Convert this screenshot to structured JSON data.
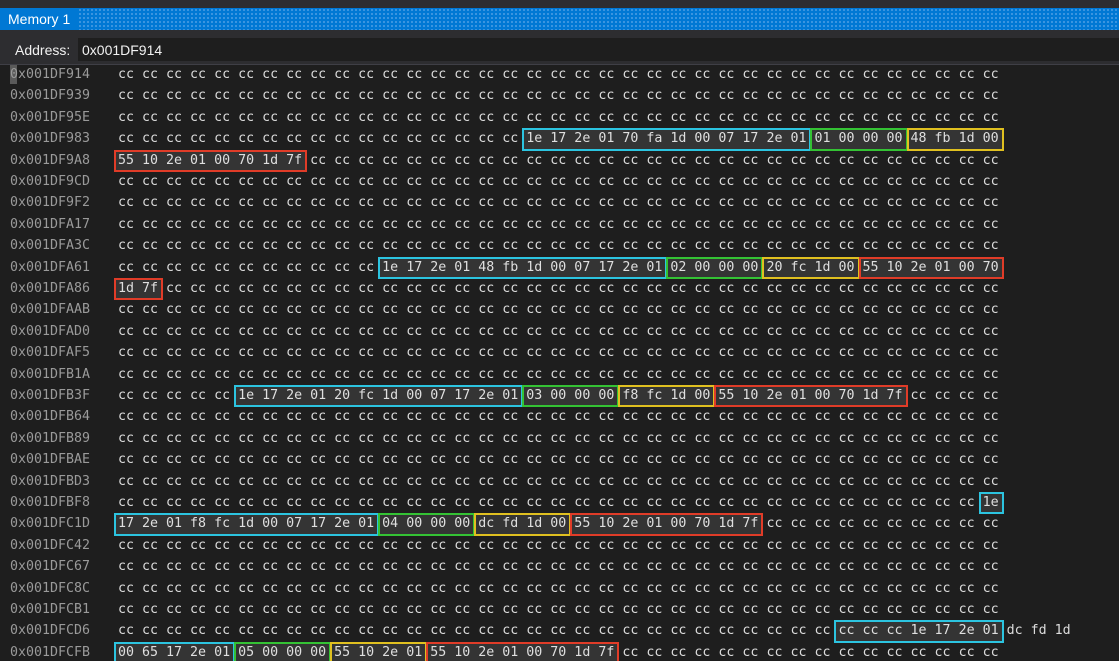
{
  "window": {
    "tab_title": "Memory 1"
  },
  "address_bar": {
    "label": "Address:",
    "value": "0x001DF914"
  },
  "colors": {
    "cyan": "#2cc4e0",
    "green": "#34c234",
    "yellow": "#e0c020",
    "red": "#e03c28"
  },
  "rows": [
    {
      "address": "0x001DF914",
      "bytes": "cc cc cc cc cc cc cc cc cc cc cc cc cc cc cc cc cc cc cc cc cc cc cc cc cc cc cc cc cc cc cc cc cc cc cc cc cc"
    },
    {
      "address": "0x001DF939",
      "bytes": "cc cc cc cc cc cc cc cc cc cc cc cc cc cc cc cc cc cc cc cc cc cc cc cc cc cc cc cc cc cc cc cc cc cc cc cc cc"
    },
    {
      "address": "0x001DF95E",
      "bytes": "cc cc cc cc cc cc cc cc cc cc cc cc cc cc cc cc cc cc cc cc cc cc cc cc cc cc cc cc cc cc cc cc cc cc cc cc cc"
    },
    {
      "address": "0x001DF983",
      "bytes": "cc cc cc cc cc cc cc cc cc cc cc cc cc cc cc cc cc 1e 17 2e 01 70 fa 1d 00 07 17 2e 01 01 00 00 00 48 fb 1d 00"
    },
    {
      "address": "0x001DF9A8",
      "bytes": "55 10 2e 01 00 70 1d 7f cc cc cc cc cc cc cc cc cc cc cc cc cc cc cc cc cc cc cc cc cc cc cc cc cc cc cc cc cc"
    },
    {
      "address": "0x001DF9CD",
      "bytes": "cc cc cc cc cc cc cc cc cc cc cc cc cc cc cc cc cc cc cc cc cc cc cc cc cc cc cc cc cc cc cc cc cc cc cc cc cc"
    },
    {
      "address": "0x001DF9F2",
      "bytes": "cc cc cc cc cc cc cc cc cc cc cc cc cc cc cc cc cc cc cc cc cc cc cc cc cc cc cc cc cc cc cc cc cc cc cc cc cc"
    },
    {
      "address": "0x001DFA17",
      "bytes": "cc cc cc cc cc cc cc cc cc cc cc cc cc cc cc cc cc cc cc cc cc cc cc cc cc cc cc cc cc cc cc cc cc cc cc cc cc"
    },
    {
      "address": "0x001DFA3C",
      "bytes": "cc cc cc cc cc cc cc cc cc cc cc cc cc cc cc cc cc cc cc cc cc cc cc cc cc cc cc cc cc cc cc cc cc cc cc cc cc"
    },
    {
      "address": "0x001DFA61",
      "bytes": "cc cc cc cc cc cc cc cc cc cc cc 1e 17 2e 01 48 fb 1d 00 07 17 2e 01 02 00 00 00 20 fc 1d 00 55 10 2e 01 00 70"
    },
    {
      "address": "0x001DFA86",
      "bytes": "1d 7f cc cc cc cc cc cc cc cc cc cc cc cc cc cc cc cc cc cc cc cc cc cc cc cc cc cc cc cc cc cc cc cc cc cc cc"
    },
    {
      "address": "0x001DFAAB",
      "bytes": "cc cc cc cc cc cc cc cc cc cc cc cc cc cc cc cc cc cc cc cc cc cc cc cc cc cc cc cc cc cc cc cc cc cc cc cc cc"
    },
    {
      "address": "0x001DFAD0",
      "bytes": "cc cc cc cc cc cc cc cc cc cc cc cc cc cc cc cc cc cc cc cc cc cc cc cc cc cc cc cc cc cc cc cc cc cc cc cc cc"
    },
    {
      "address": "0x001DFAF5",
      "bytes": "cc cc cc cc cc cc cc cc cc cc cc cc cc cc cc cc cc cc cc cc cc cc cc cc cc cc cc cc cc cc cc cc cc cc cc cc cc"
    },
    {
      "address": "0x001DFB1A",
      "bytes": "cc cc cc cc cc cc cc cc cc cc cc cc cc cc cc cc cc cc cc cc cc cc cc cc cc cc cc cc cc cc cc cc cc cc cc cc cc"
    },
    {
      "address": "0x001DFB3F",
      "bytes": "cc cc cc cc cc 1e 17 2e 01 20 fc 1d 00 07 17 2e 01 03 00 00 00 f8 fc 1d 00 55 10 2e 01 00 70 1d 7f cc cc cc cc"
    },
    {
      "address": "0x001DFB64",
      "bytes": "cc cc cc cc cc cc cc cc cc cc cc cc cc cc cc cc cc cc cc cc cc cc cc cc cc cc cc cc cc cc cc cc cc cc cc cc cc"
    },
    {
      "address": "0x001DFB89",
      "bytes": "cc cc cc cc cc cc cc cc cc cc cc cc cc cc cc cc cc cc cc cc cc cc cc cc cc cc cc cc cc cc cc cc cc cc cc cc cc"
    },
    {
      "address": "0x001DFBAE",
      "bytes": "cc cc cc cc cc cc cc cc cc cc cc cc cc cc cc cc cc cc cc cc cc cc cc cc cc cc cc cc cc cc cc cc cc cc cc cc cc"
    },
    {
      "address": "0x001DFBD3",
      "bytes": "cc cc cc cc cc cc cc cc cc cc cc cc cc cc cc cc cc cc cc cc cc cc cc cc cc cc cc cc cc cc cc cc cc cc cc cc cc"
    },
    {
      "address": "0x001DFBF8",
      "bytes": "cc cc cc cc cc cc cc cc cc cc cc cc cc cc cc cc cc cc cc cc cc cc cc cc cc cc cc cc cc cc cc cc cc cc cc cc 1e"
    },
    {
      "address": "0x001DFC1D",
      "bytes": "17 2e 01 f8 fc 1d 00 07 17 2e 01 04 00 00 00 dc fd 1d 00 55 10 2e 01 00 70 1d 7f cc cc cc cc cc cc cc cc cc cc"
    },
    {
      "address": "0x001DFC42",
      "bytes": "cc cc cc cc cc cc cc cc cc cc cc cc cc cc cc cc cc cc cc cc cc cc cc cc cc cc cc cc cc cc cc cc cc cc cc cc cc"
    },
    {
      "address": "0x001DFC67",
      "bytes": "cc cc cc cc cc cc cc cc cc cc cc cc cc cc cc cc cc cc cc cc cc cc cc cc cc cc cc cc cc cc cc cc cc cc cc cc cc"
    },
    {
      "address": "0x001DFC8C",
      "bytes": "cc cc cc cc cc cc cc cc cc cc cc cc cc cc cc cc cc cc cc cc cc cc cc cc cc cc cc cc cc cc cc cc cc cc cc cc cc"
    },
    {
      "address": "0x001DFCB1",
      "bytes": "cc cc cc cc cc cc cc cc cc cc cc cc cc cc cc cc cc cc cc cc cc cc cc cc cc cc cc cc cc cc cc cc cc cc cc cc cc"
    },
    {
      "address": "0x001DFCD6",
      "bytes": "cc cc cc cc cc cc cc cc cc cc cc cc cc cc cc cc cc cc cc cc cc cc cc cc cc cc cc cc cc cc cc cc cc 1e 17 2e 01 dc fd 1d"
    },
    {
      "address": "0x001DFCFB",
      "bytes": "00 65 17 2e 01 05 00 00 00 55 10 2e 01 55 10 2e 01 00 70 1d 7f cc cc cc cc cc cc cc cc cc cc cc cc cc cc cc cc"
    }
  ],
  "highlights": [
    {
      "row": 3,
      "start": 17,
      "length": 12,
      "color": "cyan"
    },
    {
      "row": 3,
      "start": 29,
      "length": 4,
      "color": "green"
    },
    {
      "row": 3,
      "start": 33,
      "length": 4,
      "color": "yellow"
    },
    {
      "row": 4,
      "start": 0,
      "length": 8,
      "color": "red"
    },
    {
      "row": 9,
      "start": 11,
      "length": 12,
      "color": "cyan"
    },
    {
      "row": 9,
      "start": 23,
      "length": 4,
      "color": "green"
    },
    {
      "row": 9,
      "start": 27,
      "length": 4,
      "color": "yellow"
    },
    {
      "row": 9,
      "start": 31,
      "length": 6,
      "color": "red"
    },
    {
      "row": 10,
      "start": 0,
      "length": 2,
      "color": "red"
    },
    {
      "row": 15,
      "start": 5,
      "length": 12,
      "color": "cyan"
    },
    {
      "row": 15,
      "start": 17,
      "length": 4,
      "color": "green"
    },
    {
      "row": 15,
      "start": 21,
      "length": 4,
      "color": "yellow"
    },
    {
      "row": 15,
      "start": 25,
      "length": 8,
      "color": "red"
    },
    {
      "row": 20,
      "start": 36,
      "length": 1,
      "color": "cyan"
    },
    {
      "row": 21,
      "start": 0,
      "length": 11,
      "color": "cyan"
    },
    {
      "row": 21,
      "start": 11,
      "length": 4,
      "color": "green"
    },
    {
      "row": 21,
      "start": 15,
      "length": 4,
      "color": "yellow"
    },
    {
      "row": 21,
      "start": 19,
      "length": 8,
      "color": "red"
    },
    {
      "row": 26,
      "start": 30,
      "length": 7,
      "color": "cyan"
    },
    {
      "row": 27,
      "start": 0,
      "length": 5,
      "color": "cyan"
    },
    {
      "row": 27,
      "start": 5,
      "length": 4,
      "color": "green"
    },
    {
      "row": 27,
      "start": 9,
      "length": 4,
      "color": "yellow"
    },
    {
      "row": 27,
      "start": 13,
      "length": 8,
      "color": "red"
    }
  ]
}
